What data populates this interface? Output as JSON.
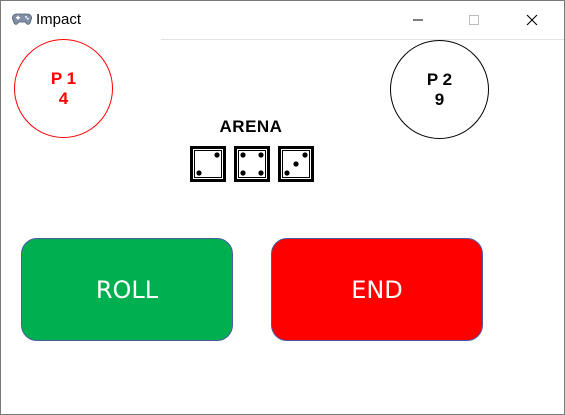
{
  "window": {
    "title": "Impact",
    "icon": "gamepad-icon",
    "controls": [
      "minimize-icon",
      "maximize-icon",
      "close-icon"
    ]
  },
  "players": [
    {
      "label": "P 1",
      "score": "4",
      "color": "#ff0000"
    },
    {
      "label": "P 2",
      "score": "9",
      "color": "#000000"
    }
  ],
  "arena": {
    "label": "ARENA",
    "dice": [
      2,
      4,
      3
    ]
  },
  "buttons": {
    "roll": {
      "label": "ROLL",
      "color": "#00b050"
    },
    "end": {
      "label": "END",
      "color": "#ff0000"
    }
  }
}
